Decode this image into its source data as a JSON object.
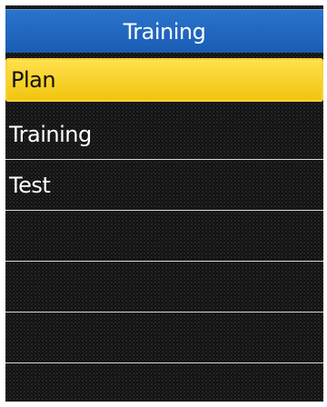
{
  "header": {
    "title": "Training"
  },
  "menu": {
    "items": [
      {
        "label": "Plan",
        "selected": true
      },
      {
        "label": "Training",
        "selected": false
      },
      {
        "label": "Test",
        "selected": false
      }
    ]
  },
  "colors": {
    "header_bg": "#1a5cb4",
    "selected_bg": "#f1c40f",
    "screen_bg": "#111111",
    "divider": "#d8d8d8"
  }
}
